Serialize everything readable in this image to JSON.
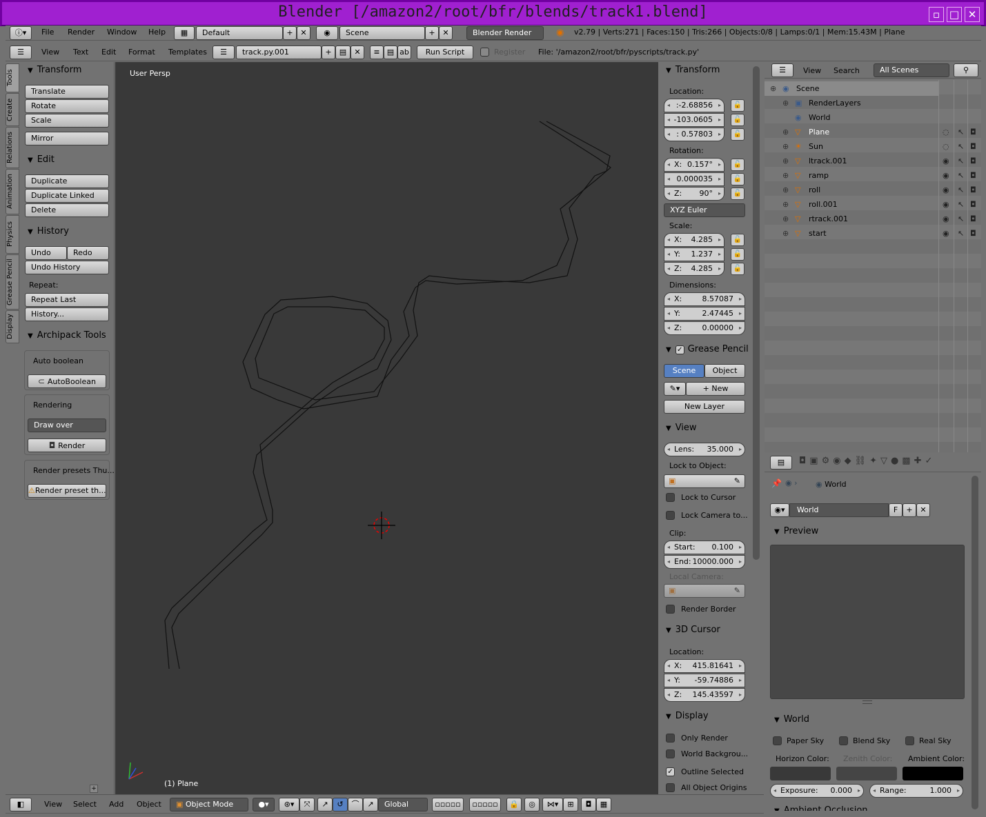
{
  "window": {
    "title": "Blender [/amazon2/root/bfr/blends/track1.blend]",
    "min_glyph": "▫",
    "max_glyph": "□",
    "close_glyph": "✕"
  },
  "info_header": {
    "menus": [
      "File",
      "Render",
      "Window",
      "Help"
    ],
    "screen_layout": "Default",
    "scene": "Scene",
    "engine": "Blender Render",
    "stats": "v2.79 | Verts:271 | Faces:150 | Tris:266 | Objects:0/8 | Lamps:0/1 | Mem:15.43M | Plane"
  },
  "text_header": {
    "menus": [
      "View",
      "Text",
      "Edit",
      "Format",
      "Templates"
    ],
    "text_name": "track.py.001",
    "run_script": "Run Script",
    "register": "Register",
    "file": "File: '/amazon2/root/bfr/pyscripts/track.py'"
  },
  "tool_tabs": [
    "Tools",
    "Create",
    "Relations",
    "Animation",
    "Physics",
    "Grease Pencil",
    "Display"
  ],
  "tools": {
    "transform": {
      "title": "Transform",
      "buttons": [
        "Translate",
        "Rotate",
        "Scale",
        "Mirror"
      ]
    },
    "edit": {
      "title": "Edit",
      "buttons": [
        "Duplicate",
        "Duplicate Linked",
        "Delete"
      ]
    },
    "history": {
      "title": "History",
      "undo": "Undo",
      "redo": "Redo",
      "undo_history": "Undo History",
      "repeat": "Repeat:",
      "repeat_last": "Repeat Last",
      "history_btn": "History..."
    },
    "archipack": {
      "title": "Archipack Tools",
      "auto_boolean": "Auto boolean",
      "autoboolean_btn": "AutoBoolean",
      "rendering": "Rendering",
      "draw_over": "Draw over",
      "render_btn": "Render",
      "presets_label": "Render presets Thu...",
      "preset_btn": "Render preset th..."
    }
  },
  "viewport": {
    "label": "User Persp",
    "object": "(1) Plane"
  },
  "n_panel": {
    "transform": {
      "title": "Transform",
      "location": "Location:",
      "loc": [
        ":-2.68856",
        "-103.0605",
        ": 0.57803"
      ],
      "rotation": "Rotation:",
      "rot": [
        {
          "k": "X:",
          "v": "0.157°"
        },
        {
          "k": "",
          "v": "0.000035"
        },
        {
          "k": "Z:",
          "v": "90°"
        }
      ],
      "euler": "XYZ Euler",
      "scale": "Scale:",
      "scl": [
        {
          "k": "X:",
          "v": "4.285"
        },
        {
          "k": "Y:",
          "v": "1.237"
        },
        {
          "k": "Z:",
          "v": "4.285"
        }
      ],
      "dimensions": "Dimensions:",
      "dim": [
        {
          "k": "X:",
          "v": "8.57087"
        },
        {
          "k": "Y:",
          "v": "2.47445"
        },
        {
          "k": "Z:",
          "v": "0.00000"
        }
      ]
    },
    "grease": {
      "title": "Grease Pencil",
      "scene": "Scene",
      "object": "Object",
      "new": "New",
      "new_layer": "New Layer"
    },
    "view": {
      "title": "View",
      "lens_k": "Lens:",
      "lens_v": "35.000",
      "lock_obj": "Lock to Object:",
      "lock_cursor": "Lock to Cursor",
      "lock_camera": "Lock Camera to...",
      "clip": "Clip:",
      "start_k": "Start:",
      "start_v": "0.100",
      "end_k": "End:",
      "end_v": "10000.000",
      "local_camera": "Local Camera:",
      "render_border": "Render Border"
    },
    "cursor": {
      "title": "3D Cursor",
      "location": "Location:",
      "x": "415.81641",
      "y": "-59.74886",
      "z": "145.43597"
    },
    "display": {
      "title": "Display",
      "only_render": "Only Render",
      "world_bg": "World Backgrou...",
      "outline": "Outline Selected",
      "all_origins": "All Object Origins"
    }
  },
  "outliner": {
    "menus": [
      "View",
      "Search"
    ],
    "filter": "All Scenes",
    "items": [
      {
        "name": "Scene",
        "type": "scene"
      },
      {
        "name": "RenderLayers",
        "type": "rl"
      },
      {
        "name": "World",
        "type": "world"
      },
      {
        "name": "Plane",
        "type": "mesh"
      },
      {
        "name": "Sun",
        "type": "lamp"
      },
      {
        "name": "ltrack.001",
        "type": "mesh"
      },
      {
        "name": "ramp",
        "type": "mesh"
      },
      {
        "name": "roll",
        "type": "mesh"
      },
      {
        "name": "roll.001",
        "type": "mesh"
      },
      {
        "name": "rtrack.001",
        "type": "mesh"
      },
      {
        "name": "start",
        "type": "mesh"
      }
    ]
  },
  "properties": {
    "context": "World",
    "world_name": "World",
    "f": "F",
    "preview": "Preview",
    "world_title": "World",
    "paper_sky": "Paper Sky",
    "blend_sky": "Blend Sky",
    "real_sky": "Real Sky",
    "horizon": "Horizon Color:",
    "zenith": "Zenith Color:",
    "ambient": "Ambient Color:",
    "exposure_k": "Exposure:",
    "exposure_v": "0.000",
    "range_k": "Range:",
    "range_v": "1.000",
    "ao": "Ambient Occlusion"
  },
  "view3d_header": {
    "menus": [
      "View",
      "Select",
      "Add",
      "Object"
    ],
    "mode": "Object Mode",
    "orientation": "Global"
  }
}
